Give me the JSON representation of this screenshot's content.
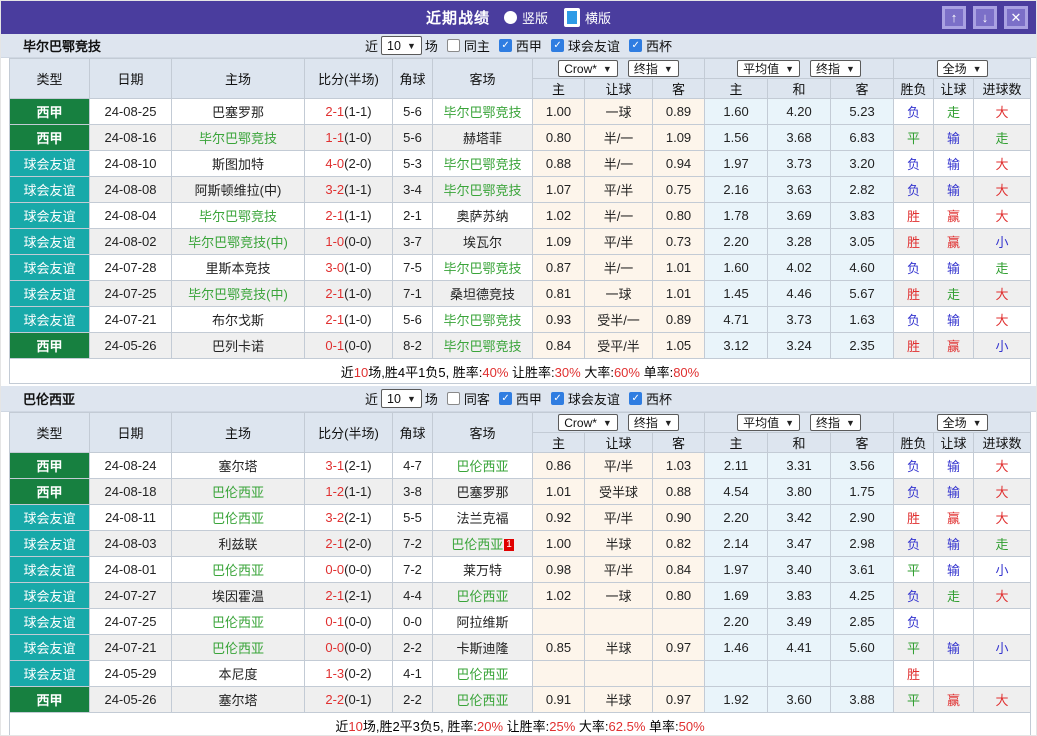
{
  "header": {
    "title": "近期战绩",
    "radio_vertical": "竖版",
    "radio_horizontal": "横版",
    "btn_up": "↑",
    "btn_down": "↓",
    "btn_close": "✕"
  },
  "colors": {
    "accent_purple": "#4a3d9e",
    "league_badge": "#178040",
    "friendly_badge": "#18a9a9",
    "team_green": "#39a439",
    "score_red": "#e03030",
    "result_blue": "#3434cf",
    "result_green": "#2f9e2f",
    "handicap_col_bg": "#fdf5eb",
    "average_col_bg": "#e9f4fa"
  },
  "filter_labels": {
    "near": "近",
    "matches_value": "10",
    "games": "场"
  },
  "dropdowns": {
    "company": "Crow*",
    "company_final": "终指",
    "average": "平均值",
    "average_final": "终指",
    "scope": "全场"
  },
  "columns": {
    "type": "类型",
    "date": "日期",
    "home": "主场",
    "score": "比分(半场)",
    "corner": "角球",
    "away": "客场",
    "odds_home": "主",
    "handicap": "让球",
    "odds_away": "客",
    "avg_home": "主",
    "avg_draw": "和",
    "avg_away": "客",
    "result": "胜负",
    "handicap_result": "让球",
    "goals": "进球数"
  },
  "sections": [
    {
      "team": "毕尔巴鄂竞技",
      "same_venue_label": "同主",
      "same_venue_checked": false,
      "leagues": [
        "西甲",
        "球会友谊",
        "西杯"
      ],
      "rows": [
        {
          "type": "西甲",
          "tc": "league",
          "date": "24-08-25",
          "home": "巴塞罗那",
          "hg": false,
          "score": "2-1",
          "half": "(1-1)",
          "corner": "5-6",
          "away": "毕尔巴鄂竞技",
          "ag": true,
          "card": "",
          "odds": [
            "1.00",
            "一球",
            "0.89"
          ],
          "avg": [
            "1.60",
            "4.20",
            "5.23"
          ],
          "res": [
            [
              "负",
              "b"
            ],
            [
              "走",
              "g"
            ],
            [
              "大",
              "r"
            ]
          ]
        },
        {
          "type": "西甲",
          "tc": "league",
          "date": "24-08-16",
          "home": "毕尔巴鄂竞技",
          "hg": true,
          "score": "1-1",
          "half": "(1-0)",
          "corner": "5-6",
          "away": "赫塔菲",
          "ag": false,
          "card": "",
          "odds": [
            "0.80",
            "半/一",
            "1.09"
          ],
          "avg": [
            "1.56",
            "3.68",
            "6.83"
          ],
          "res": [
            [
              "平",
              "g"
            ],
            [
              "输",
              "b"
            ],
            [
              "走",
              "g"
            ]
          ]
        },
        {
          "type": "球会友谊",
          "tc": "friendly",
          "date": "24-08-10",
          "home": "斯图加特",
          "hg": false,
          "score": "4-0",
          "half": "(2-0)",
          "corner": "5-3",
          "away": "毕尔巴鄂竞技",
          "ag": true,
          "card": "",
          "odds": [
            "0.88",
            "半/一",
            "0.94"
          ],
          "avg": [
            "1.97",
            "3.73",
            "3.20"
          ],
          "res": [
            [
              "负",
              "b"
            ],
            [
              "输",
              "b"
            ],
            [
              "大",
              "r"
            ]
          ]
        },
        {
          "type": "球会友谊",
          "tc": "friendly",
          "date": "24-08-08",
          "home": "阿斯顿维拉(中)",
          "hg": false,
          "score": "3-2",
          "half": "(1-1)",
          "corner": "3-4",
          "away": "毕尔巴鄂竞技",
          "ag": true,
          "card": "",
          "odds": [
            "1.07",
            "平/半",
            "0.75"
          ],
          "avg": [
            "2.16",
            "3.63",
            "2.82"
          ],
          "res": [
            [
              "负",
              "b"
            ],
            [
              "输",
              "b"
            ],
            [
              "大",
              "r"
            ]
          ]
        },
        {
          "type": "球会友谊",
          "tc": "friendly",
          "date": "24-08-04",
          "home": "毕尔巴鄂竞技",
          "hg": true,
          "score": "2-1",
          "half": "(1-1)",
          "corner": "2-1",
          "away": "奥萨苏纳",
          "ag": false,
          "card": "",
          "odds": [
            "1.02",
            "半/一",
            "0.80"
          ],
          "avg": [
            "1.78",
            "3.69",
            "3.83"
          ],
          "res": [
            [
              "胜",
              "r"
            ],
            [
              "赢",
              "r"
            ],
            [
              "大",
              "r"
            ]
          ]
        },
        {
          "type": "球会友谊",
          "tc": "friendly",
          "date": "24-08-02",
          "home": "毕尔巴鄂竞技(中)",
          "hg": true,
          "score": "1-0",
          "half": "(0-0)",
          "corner": "3-7",
          "away": "埃瓦尔",
          "ag": false,
          "card": "",
          "odds": [
            "1.09",
            "平/半",
            "0.73"
          ],
          "avg": [
            "2.20",
            "3.28",
            "3.05"
          ],
          "res": [
            [
              "胜",
              "r"
            ],
            [
              "赢",
              "r"
            ],
            [
              "小",
              "b"
            ]
          ]
        },
        {
          "type": "球会友谊",
          "tc": "friendly",
          "date": "24-07-28",
          "home": "里斯本竞技",
          "hg": false,
          "score": "3-0",
          "half": "(1-0)",
          "corner": "7-5",
          "away": "毕尔巴鄂竞技",
          "ag": true,
          "card": "",
          "odds": [
            "0.87",
            "半/一",
            "1.01"
          ],
          "avg": [
            "1.60",
            "4.02",
            "4.60"
          ],
          "res": [
            [
              "负",
              "b"
            ],
            [
              "输",
              "b"
            ],
            [
              "走",
              "g"
            ]
          ]
        },
        {
          "type": "球会友谊",
          "tc": "friendly",
          "date": "24-07-25",
          "home": "毕尔巴鄂竞技(中)",
          "hg": true,
          "score": "2-1",
          "half": "(1-0)",
          "corner": "7-1",
          "away": "桑坦德竞技",
          "ag": false,
          "card": "",
          "odds": [
            "0.81",
            "一球",
            "1.01"
          ],
          "avg": [
            "1.45",
            "4.46",
            "5.67"
          ],
          "res": [
            [
              "胜",
              "r"
            ],
            [
              "走",
              "g"
            ],
            [
              "大",
              "r"
            ]
          ]
        },
        {
          "type": "球会友谊",
          "tc": "friendly",
          "date": "24-07-21",
          "home": "布尔戈斯",
          "hg": false,
          "score": "2-1",
          "half": "(1-0)",
          "corner": "5-6",
          "away": "毕尔巴鄂竞技",
          "ag": true,
          "card": "",
          "odds": [
            "0.93",
            "受半/一",
            "0.89"
          ],
          "avg": [
            "4.71",
            "3.73",
            "1.63"
          ],
          "res": [
            [
              "负",
              "b"
            ],
            [
              "输",
              "b"
            ],
            [
              "大",
              "r"
            ]
          ]
        },
        {
          "type": "西甲",
          "tc": "league",
          "date": "24-05-26",
          "home": "巴列卡诺",
          "hg": false,
          "score": "0-1",
          "half": "(0-0)",
          "corner": "8-2",
          "away": "毕尔巴鄂竞技",
          "ag": true,
          "card": "",
          "odds": [
            "0.84",
            "受平/半",
            "1.05"
          ],
          "avg": [
            "3.12",
            "3.24",
            "2.35"
          ],
          "res": [
            [
              "胜",
              "r"
            ],
            [
              "赢",
              "r"
            ],
            [
              "小",
              "b"
            ]
          ]
        }
      ],
      "summary": [
        {
          "t": "近"
        },
        {
          "t": "10",
          "red": true
        },
        {
          "t": "场,胜4平1负5, 胜率:"
        },
        {
          "t": "40%",
          "red": true
        },
        {
          "t": " 让胜率:"
        },
        {
          "t": "30%",
          "red": true
        },
        {
          "t": " 大率:"
        },
        {
          "t": "60%",
          "red": true
        },
        {
          "t": " 单率:"
        },
        {
          "t": "80%",
          "red": true
        }
      ]
    },
    {
      "team": "巴伦西亚",
      "same_venue_label": "同客",
      "same_venue_checked": false,
      "leagues": [
        "西甲",
        "球会友谊",
        "西杯"
      ],
      "rows": [
        {
          "type": "西甲",
          "tc": "league",
          "date": "24-08-24",
          "home": "塞尔塔",
          "hg": false,
          "score": "3-1",
          "half": "(2-1)",
          "corner": "4-7",
          "away": "巴伦西亚",
          "ag": true,
          "card": "",
          "odds": [
            "0.86",
            "平/半",
            "1.03"
          ],
          "avg": [
            "2.11",
            "3.31",
            "3.56"
          ],
          "res": [
            [
              "负",
              "b"
            ],
            [
              "输",
              "b"
            ],
            [
              "大",
              "r"
            ]
          ]
        },
        {
          "type": "西甲",
          "tc": "league",
          "date": "24-08-18",
          "home": "巴伦西亚",
          "hg": true,
          "score": "1-2",
          "half": "(1-1)",
          "corner": "3-8",
          "away": "巴塞罗那",
          "ag": false,
          "card": "",
          "odds": [
            "1.01",
            "受半球",
            "0.88"
          ],
          "avg": [
            "4.54",
            "3.80",
            "1.75"
          ],
          "res": [
            [
              "负",
              "b"
            ],
            [
              "输",
              "b"
            ],
            [
              "大",
              "r"
            ]
          ]
        },
        {
          "type": "球会友谊",
          "tc": "friendly",
          "date": "24-08-11",
          "home": "巴伦西亚",
          "hg": true,
          "score": "3-2",
          "half": "(2-1)",
          "corner": "5-5",
          "away": "法兰克福",
          "ag": false,
          "card": "",
          "odds": [
            "0.92",
            "平/半",
            "0.90"
          ],
          "avg": [
            "2.20",
            "3.42",
            "2.90"
          ],
          "res": [
            [
              "胜",
              "r"
            ],
            [
              "赢",
              "r"
            ],
            [
              "大",
              "r"
            ]
          ]
        },
        {
          "type": "球会友谊",
          "tc": "friendly",
          "date": "24-08-03",
          "home": "利兹联",
          "hg": false,
          "score": "2-1",
          "half": "(2-0)",
          "corner": "7-2",
          "away": "巴伦西亚",
          "ag": true,
          "card": "1",
          "odds": [
            "1.00",
            "半球",
            "0.82"
          ],
          "avg": [
            "2.14",
            "3.47",
            "2.98"
          ],
          "res": [
            [
              "负",
              "b"
            ],
            [
              "输",
              "b"
            ],
            [
              "走",
              "g"
            ]
          ]
        },
        {
          "type": "球会友谊",
          "tc": "friendly",
          "date": "24-08-01",
          "home": "巴伦西亚",
          "hg": true,
          "score": "0-0",
          "half": "(0-0)",
          "corner": "7-2",
          "away": "莱万特",
          "ag": false,
          "card": "",
          "odds": [
            "0.98",
            "平/半",
            "0.84"
          ],
          "avg": [
            "1.97",
            "3.40",
            "3.61"
          ],
          "res": [
            [
              "平",
              "g"
            ],
            [
              "输",
              "b"
            ],
            [
              "小",
              "b"
            ]
          ]
        },
        {
          "type": "球会友谊",
          "tc": "friendly",
          "date": "24-07-27",
          "home": "埃因霍温",
          "hg": false,
          "score": "2-1",
          "half": "(2-1)",
          "corner": "4-4",
          "away": "巴伦西亚",
          "ag": true,
          "card": "",
          "odds": [
            "1.02",
            "一球",
            "0.80"
          ],
          "avg": [
            "1.69",
            "3.83",
            "4.25"
          ],
          "res": [
            [
              "负",
              "b"
            ],
            [
              "走",
              "g"
            ],
            [
              "大",
              "r"
            ]
          ]
        },
        {
          "type": "球会友谊",
          "tc": "friendly",
          "date": "24-07-25",
          "home": "巴伦西亚",
          "hg": true,
          "score": "0-1",
          "half": "(0-0)",
          "corner": "0-0",
          "away": "阿拉维斯",
          "ag": false,
          "card": "",
          "odds": [
            "",
            "",
            ""
          ],
          "avg": [
            "2.20",
            "3.49",
            "2.85"
          ],
          "res": [
            [
              "负",
              "b"
            ],
            [
              "",
              ""
            ],
            [
              "",
              ""
            ]
          ]
        },
        {
          "type": "球会友谊",
          "tc": "friendly",
          "date": "24-07-21",
          "home": "巴伦西亚",
          "hg": true,
          "score": "0-0",
          "half": "(0-0)",
          "corner": "2-2",
          "away": "卡斯迪隆",
          "ag": false,
          "card": "",
          "odds": [
            "0.85",
            "半球",
            "0.97"
          ],
          "avg": [
            "1.46",
            "4.41",
            "5.60"
          ],
          "res": [
            [
              "平",
              "g"
            ],
            [
              "输",
              "b"
            ],
            [
              "小",
              "b"
            ]
          ]
        },
        {
          "type": "球会友谊",
          "tc": "friendly",
          "date": "24-05-29",
          "home": "本尼度",
          "hg": false,
          "score": "1-3",
          "half": "(0-2)",
          "corner": "4-1",
          "away": "巴伦西亚",
          "ag": true,
          "card": "",
          "odds": [
            "",
            "",
            ""
          ],
          "avg": [
            "",
            "",
            ""
          ],
          "res": [
            [
              "胜",
              "r"
            ],
            [
              "",
              ""
            ],
            [
              "",
              ""
            ]
          ]
        },
        {
          "type": "西甲",
          "tc": "league",
          "date": "24-05-26",
          "home": "塞尔塔",
          "hg": false,
          "score": "2-2",
          "half": "(0-1)",
          "corner": "2-2",
          "away": "巴伦西亚",
          "ag": true,
          "card": "",
          "odds": [
            "0.91",
            "半球",
            "0.97"
          ],
          "avg": [
            "1.92",
            "3.60",
            "3.88"
          ],
          "res": [
            [
              "平",
              "g"
            ],
            [
              "赢",
              "r"
            ],
            [
              "大",
              "r"
            ]
          ]
        }
      ],
      "summary": [
        {
          "t": "近"
        },
        {
          "t": "10",
          "red": true
        },
        {
          "t": "场,胜2平3负5, 胜率:"
        },
        {
          "t": "20%",
          "red": true
        },
        {
          "t": " 让胜率:"
        },
        {
          "t": "25%",
          "red": true
        },
        {
          "t": " 大率:"
        },
        {
          "t": "62.5%",
          "red": true
        },
        {
          "t": " 单率:"
        },
        {
          "t": "50%",
          "red": true
        }
      ]
    }
  ]
}
